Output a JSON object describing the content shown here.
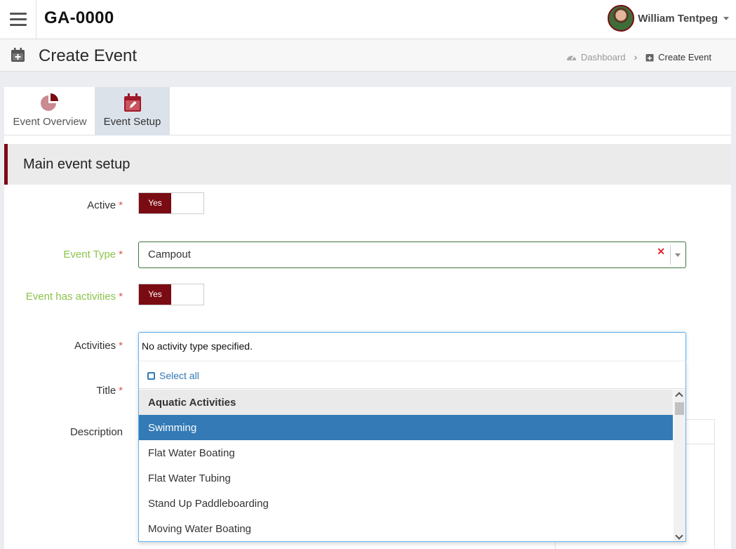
{
  "app": {
    "title": "GA-0000"
  },
  "user": {
    "name": "William Tentpeg"
  },
  "page": {
    "title": "Create Event"
  },
  "breadcrumb": {
    "home": "Dashboard",
    "current": "Create Event"
  },
  "tabs": [
    {
      "label": "Event Overview",
      "active": false
    },
    {
      "label": "Event Setup",
      "active": true
    }
  ],
  "section": {
    "title": "Main event setup"
  },
  "form": {
    "active": {
      "label": "Active",
      "toggle": "Yes"
    },
    "event_type": {
      "label": "Event Type",
      "value": "Campout"
    },
    "has_activities": {
      "label": "Event has activities",
      "toggle": "Yes"
    },
    "activities": {
      "label": "Activities",
      "placeholder": "No activity type specified."
    },
    "title": {
      "label": "Title"
    },
    "description": {
      "label": "Description"
    },
    "required_mark": "*"
  },
  "dropdown": {
    "select_all": "Select all",
    "group": "Aquatic Activities",
    "options": [
      "Swimming",
      "Flat Water Boating",
      "Flat Water Tubing",
      "Stand Up Paddleboarding",
      "Moving Water Boating"
    ],
    "selected_index": 0
  },
  "colors": {
    "brand": "#7a0b13",
    "valid": "#8bc34a",
    "selected": "#337ab7",
    "required": "#d9534f"
  }
}
